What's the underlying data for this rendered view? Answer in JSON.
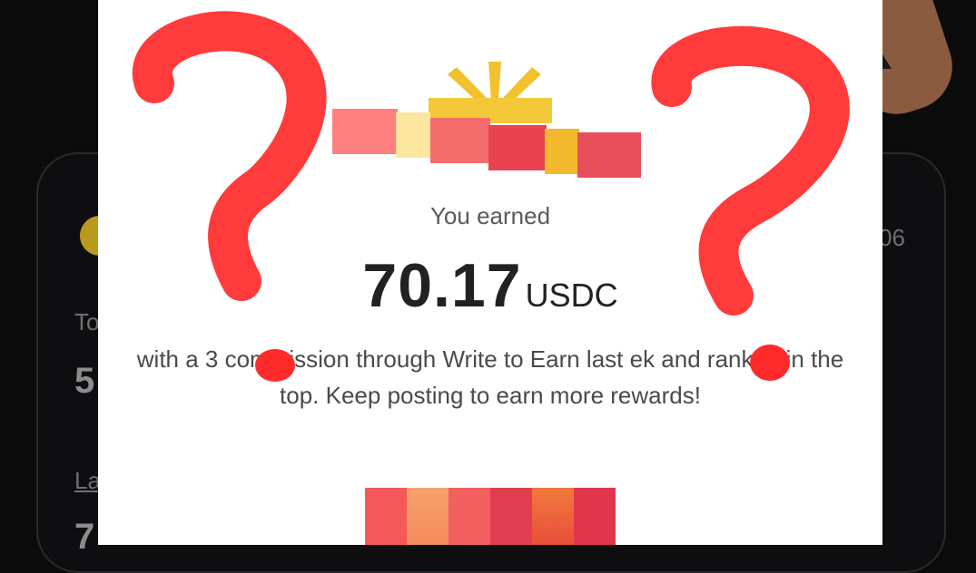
{
  "background": {
    "stat_label_1": "To",
    "stat_value_1": "5",
    "stat_label_2": "La",
    "stat_value_2": "7",
    "right_value": "06"
  },
  "modal": {
    "earned_label": "You earned",
    "amount": "70.17",
    "currency": "USDC",
    "message": "with a 3   commission through Write to Earn last    ek and ranked in the top. Keep posting to earn more rewards!"
  },
  "colors": {
    "overlay_red": "#ff3b3b",
    "gift_gold": "#f2c12e",
    "backdrop": "#0b0b0c"
  },
  "icons": [
    "gift-icon",
    "question-mark-left",
    "question-mark-right",
    "redaction-dot"
  ]
}
